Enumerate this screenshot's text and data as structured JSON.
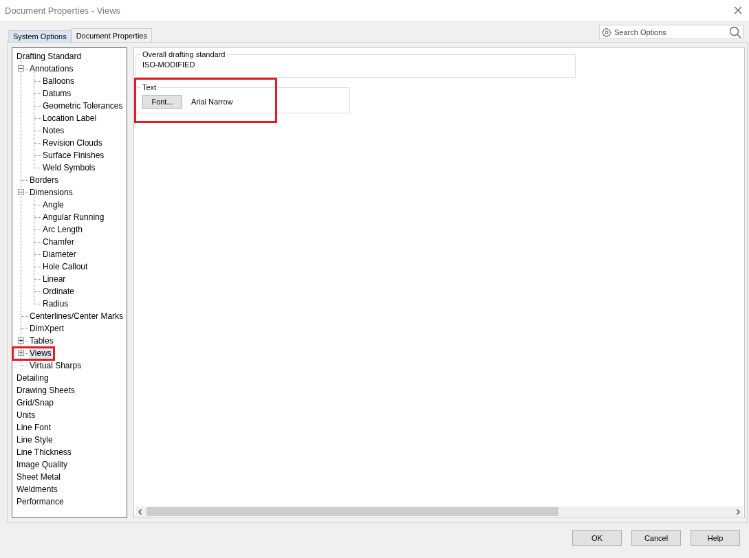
{
  "window": {
    "title": "Document Properties - Views"
  },
  "tabs": [
    {
      "label": "System Options",
      "selected": false
    },
    {
      "label": "Document Properties",
      "selected": true
    }
  ],
  "search": {
    "placeholder": "Search Options"
  },
  "tree": [
    {
      "label": "Drafting Standard",
      "selected": false,
      "marked": false,
      "children": [
        {
          "label": "Annotations",
          "selected": false,
          "marked": false,
          "expanded": true,
          "children": [
            {
              "label": "Balloons",
              "selected": false,
              "marked": false
            },
            {
              "label": "Datums",
              "selected": false,
              "marked": false
            },
            {
              "label": "Geometric Tolerances",
              "selected": false,
              "marked": false
            },
            {
              "label": "Location Label",
              "selected": false,
              "marked": false
            },
            {
              "label": "Notes",
              "selected": false,
              "marked": false
            },
            {
              "label": "Revision Clouds",
              "selected": false,
              "marked": false
            },
            {
              "label": "Surface Finishes",
              "selected": false,
              "marked": false
            },
            {
              "label": "Weld Symbols",
              "selected": false,
              "marked": false
            }
          ]
        },
        {
          "label": "Borders",
          "selected": false,
          "marked": false
        },
        {
          "label": "Dimensions",
          "selected": false,
          "marked": false,
          "expanded": true,
          "children": [
            {
              "label": "Angle",
              "selected": false,
              "marked": false
            },
            {
              "label": "Angular Running",
              "selected": false,
              "marked": false
            },
            {
              "label": "Arc Length",
              "selected": false,
              "marked": false
            },
            {
              "label": "Chamfer",
              "selected": false,
              "marked": false
            },
            {
              "label": "Diameter",
              "selected": false,
              "marked": false
            },
            {
              "label": "Hole Callout",
              "selected": false,
              "marked": false
            },
            {
              "label": "Linear",
              "selected": false,
              "marked": false
            },
            {
              "label": "Ordinate",
              "selected": false,
              "marked": false
            },
            {
              "label": "Radius",
              "selected": false,
              "marked": false
            }
          ]
        },
        {
          "label": "Centerlines/Center Marks",
          "selected": false,
          "marked": false
        },
        {
          "label": "DimXpert",
          "selected": false,
          "marked": false
        },
        {
          "label": "Tables",
          "selected": false,
          "marked": false,
          "expanded": false
        },
        {
          "label": "Views",
          "selected": true,
          "marked": true,
          "expanded": false
        },
        {
          "label": "Virtual Sharps",
          "selected": false,
          "marked": false
        }
      ]
    },
    {
      "label": "Detailing",
      "selected": false,
      "marked": false
    },
    {
      "label": "Drawing Sheets",
      "selected": false,
      "marked": false
    },
    {
      "label": "Grid/Snap",
      "selected": false,
      "marked": false
    },
    {
      "label": "Units",
      "selected": false,
      "marked": false
    },
    {
      "label": "Line Font",
      "selected": false,
      "marked": false
    },
    {
      "label": "Line Style",
      "selected": false,
      "marked": false
    },
    {
      "label": "Line Thickness",
      "selected": false,
      "marked": false
    },
    {
      "label": "Image Quality",
      "selected": false,
      "marked": false
    },
    {
      "label": "Sheet Metal",
      "selected": false,
      "marked": false
    },
    {
      "label": "Weldments",
      "selected": false,
      "marked": false
    },
    {
      "label": "Performance",
      "selected": false,
      "marked": false
    }
  ],
  "drafting_standard": {
    "label": "Overall drafting standard",
    "value": "ISO-MODIFIED"
  },
  "text_group": {
    "label": "Text",
    "button": "Font...",
    "font": "Arial Narrow",
    "marked": true
  },
  "buttons": [
    "OK",
    "Cancel",
    "Help"
  ]
}
